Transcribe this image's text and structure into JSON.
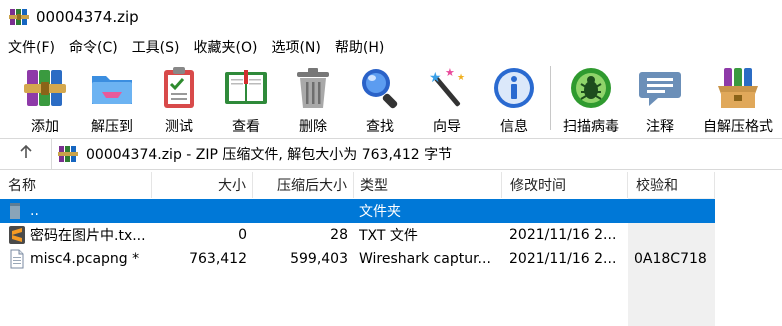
{
  "window": {
    "title": "00004374.zip"
  },
  "menu": [
    "文件(F)",
    "命令(C)",
    "工具(S)",
    "收藏夹(O)",
    "选项(N)",
    "帮助(H)"
  ],
  "toolbar": {
    "add": "添加",
    "extract_to": "解压到",
    "test": "测试",
    "view": "查看",
    "delete": "删除",
    "find": "查找",
    "wizard": "向导",
    "info": "信息",
    "virus_scan": "扫描病毒",
    "comment": "注释",
    "sfx": "自解压格式"
  },
  "address": {
    "text": "00004374.zip - ZIP 压缩文件, 解包大小为 763,412 字节"
  },
  "columns": {
    "name": "名称",
    "size": "大小",
    "packed": "压缩后大小",
    "type": "类型",
    "modified": "修改时间",
    "checksum": "校验和"
  },
  "files": [
    {
      "name": "..",
      "size": "",
      "packed": "",
      "type": "文件夹",
      "modified": "",
      "checksum": "",
      "icon": "folder-up-icon"
    },
    {
      "name": "密码在图片中.tx...",
      "size": "0",
      "packed": "28",
      "type": "TXT 文件",
      "modified": "2021/11/16 2...",
      "checksum": "",
      "icon": "sublime-file-icon"
    },
    {
      "name": "misc4.pcapng *",
      "size": "763,412",
      "packed": "599,403",
      "type": "Wireshark captur...",
      "modified": "2021/11/16 2...",
      "checksum": "0A18C718",
      "icon": "generic-file-icon"
    }
  ],
  "colors": {
    "selection": "#0078d7",
    "checksum_bg": "#f0f0f0"
  }
}
